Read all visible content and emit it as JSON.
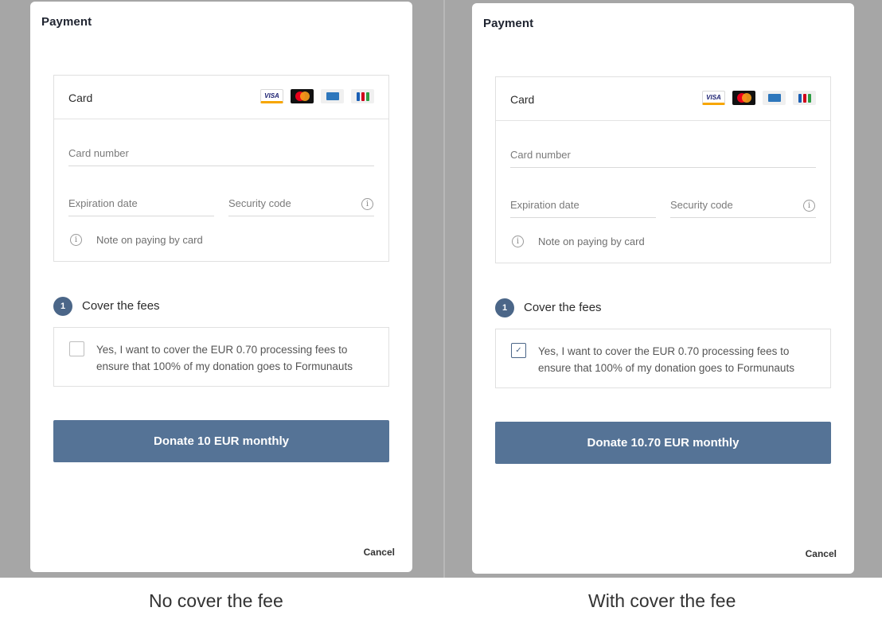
{
  "panels": [
    {
      "title": "Payment",
      "card_label": "Card",
      "card_logos": [
        "visa-logo",
        "mastercard-logo",
        "amex-logo",
        "jcb-logo"
      ],
      "visa_text": "VISA",
      "card_number_placeholder": "Card number",
      "expiration_placeholder": "Expiration date",
      "security_placeholder": "Security code",
      "note": "Note on paying by card",
      "step_number": "1",
      "fees_title": "Cover the fees",
      "fee_checked": false,
      "fee_text": "Yes, I want to cover the EUR 0.70 processing fees to ensure that 100% of my donation goes to Formunauts",
      "donate_label": "Donate 10 EUR monthly",
      "cancel_label": "Cancel",
      "caption": "No cover the fee"
    },
    {
      "title": "Payment",
      "card_label": "Card",
      "card_logos": [
        "visa-logo",
        "mastercard-logo",
        "amex-logo",
        "jcb-logo"
      ],
      "visa_text": "VISA",
      "card_number_placeholder": "Card number",
      "expiration_placeholder": "Expiration date",
      "security_placeholder": "Security code",
      "note": "Note on paying by card",
      "step_number": "1",
      "fees_title": "Cover the fees",
      "fee_checked": true,
      "fee_text": "Yes, I want to cover the EUR 0.70 processing fees to ensure that 100% of my donation goes to Formunauts",
      "donate_label": "Donate 10.70 EUR monthly",
      "cancel_label": "Cancel",
      "caption": "With cover the fee"
    }
  ],
  "colors": {
    "backdrop": "#a6a6a6",
    "accent": "#557396",
    "badge": "#4b6688"
  },
  "check_glyph": "✓",
  "info_glyph": "i"
}
